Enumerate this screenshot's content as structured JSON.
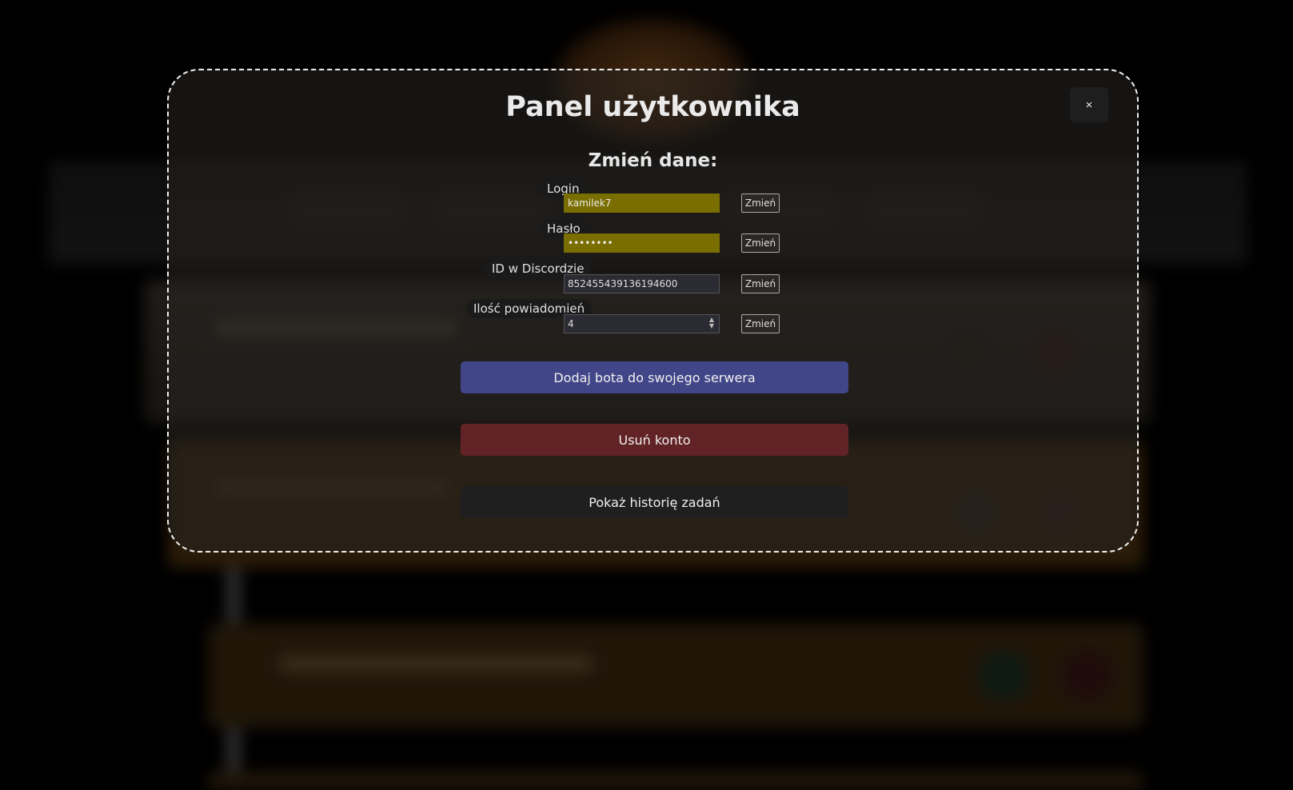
{
  "modal": {
    "title": "Panel użytkownika",
    "close_label": "×",
    "section_title": "Zmień dane:"
  },
  "fields": [
    {
      "label": "Login",
      "value": "kamilek7",
      "type": "text",
      "change_label": "Zmień"
    },
    {
      "label": "Hasło",
      "value": "••••••••",
      "type": "password",
      "change_label": "Zmień"
    },
    {
      "label": "ID w Discordzie",
      "value": "852455439136194600",
      "type": "text",
      "change_label": "Zmień"
    },
    {
      "label": "Ilość powiadomień",
      "value": "4",
      "type": "number",
      "change_label": "Zmień"
    }
  ],
  "buttons": {
    "add_bot": "Dodaj bota do swojego serwera",
    "delete_account": "Usuń konto",
    "show_history": "Pokaż historię zadań"
  },
  "colors": {
    "autofill": "#7a6e00",
    "add_bot": "#414688",
    "delete_account": "#622326",
    "show_history": "#1f1f1f"
  },
  "icons": {
    "close": "close-icon",
    "spinner": "number-spinner-icon"
  }
}
